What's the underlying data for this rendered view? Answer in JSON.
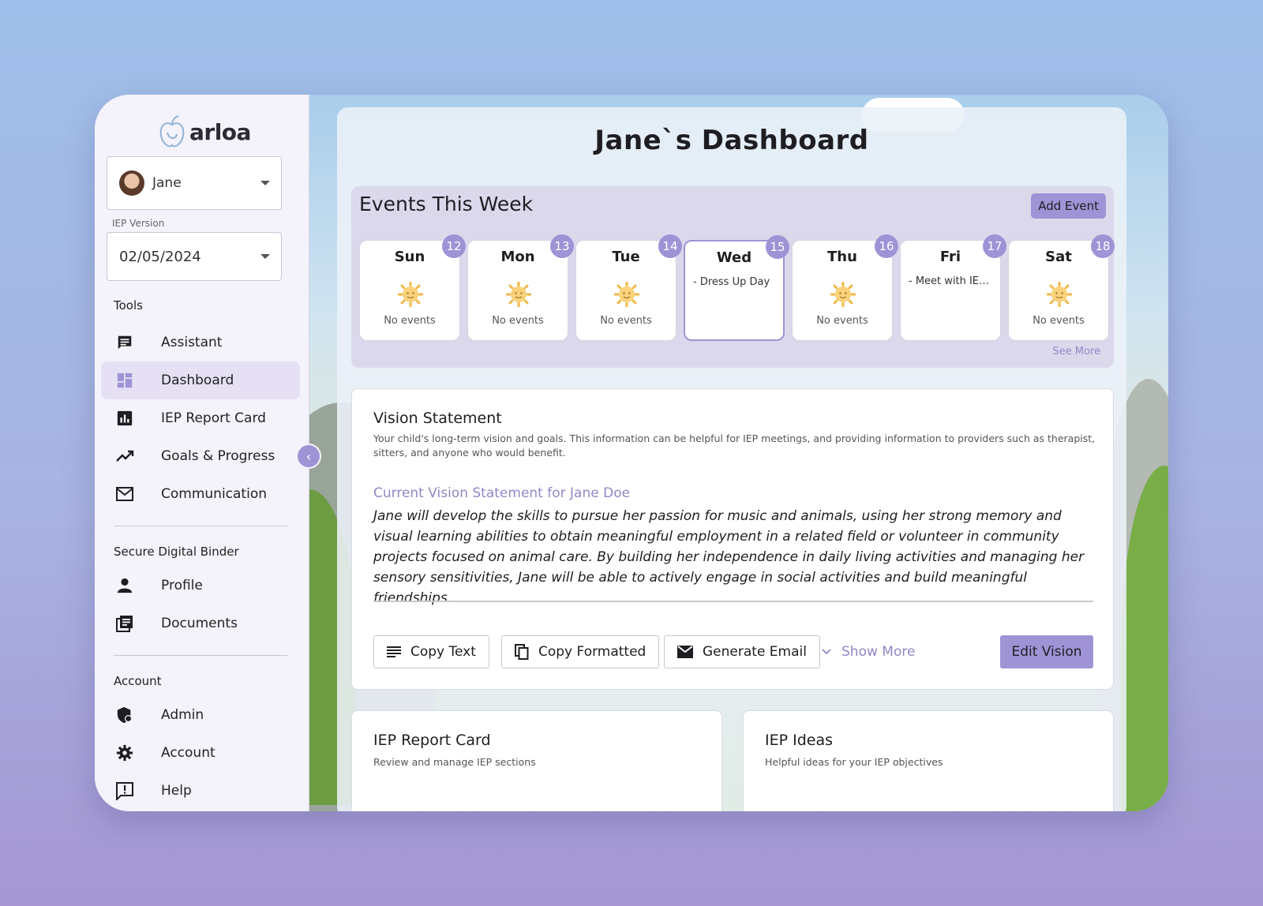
{
  "brand": {
    "name": "arloa"
  },
  "user": {
    "name": "Jane"
  },
  "iep_version": {
    "label": "IEP Version",
    "value": "02/05/2024"
  },
  "sidebar": {
    "tools_title": "Tools",
    "tools": [
      {
        "label": "Assistant",
        "icon": "chat-icon"
      },
      {
        "label": "Dashboard",
        "icon": "dashboard-icon",
        "active": true
      },
      {
        "label": "IEP Report Card",
        "icon": "bar-chart-icon"
      },
      {
        "label": "Goals & Progress",
        "icon": "trending-up-icon"
      },
      {
        "label": "Communication",
        "icon": "mail-icon"
      }
    ],
    "binder_title": "Secure Digital Binder",
    "binder": [
      {
        "label": "Profile",
        "icon": "person-icon"
      },
      {
        "label": "Documents",
        "icon": "documents-icon"
      }
    ],
    "account_title": "Account",
    "account": [
      {
        "label": "Admin",
        "icon": "admin-shield-icon"
      },
      {
        "label": "Account",
        "icon": "gear-icon"
      },
      {
        "label": "Help",
        "icon": "help-icon"
      }
    ]
  },
  "page": {
    "title": "Jane`s Dashboard"
  },
  "events": {
    "title": "Events This Week",
    "add_label": "Add Event",
    "see_more": "See More",
    "days": [
      {
        "name": "Sun",
        "date": "12",
        "empty_text": "No events",
        "event": ""
      },
      {
        "name": "Mon",
        "date": "13",
        "empty_text": "No events",
        "event": ""
      },
      {
        "name": "Tue",
        "date": "14",
        "empty_text": "No events",
        "event": ""
      },
      {
        "name": "Wed",
        "date": "15",
        "empty_text": "",
        "event": "- Dress Up Day",
        "today": true
      },
      {
        "name": "Thu",
        "date": "16",
        "empty_text": "No events",
        "event": ""
      },
      {
        "name": "Fri",
        "date": "17",
        "empty_text": "",
        "event": "- Meet with IEP ..."
      },
      {
        "name": "Sat",
        "date": "18",
        "empty_text": "No events",
        "event": ""
      }
    ]
  },
  "vision": {
    "title": "Vision Statement",
    "subtitle": "Your child's long-term vision and goals. This information can be helpful for IEP meetings, and providing information to providers such as therapist, sitters, and anyone who would benefit.",
    "heading": "Current Vision Statement for Jane Doe",
    "text": "Jane will develop the skills to pursue her passion for music and animals, using her strong memory and visual learning abilities to obtain meaningful employment in a related field or volunteer in community projects focused on animal care. By building her independence in daily living activities and managing her sensory sensitivities, Jane will be able to actively engage in social activities and build meaningful friendships.",
    "copy_text": "Copy Text",
    "copy_formatted": "Copy Formatted",
    "generate_email": "Generate Email",
    "show_more": "Show More",
    "edit": "Edit Vision"
  },
  "report_card": {
    "title": "IEP Report Card",
    "subtitle": "Review and manage IEP sections"
  },
  "ideas": {
    "title": "IEP Ideas",
    "subtitle": "Helpful ideas for your IEP objectives"
  },
  "colors": {
    "accent": "#9f93d6",
    "accent_text": "#9088c6",
    "active_nav": "#e6e0f4"
  }
}
